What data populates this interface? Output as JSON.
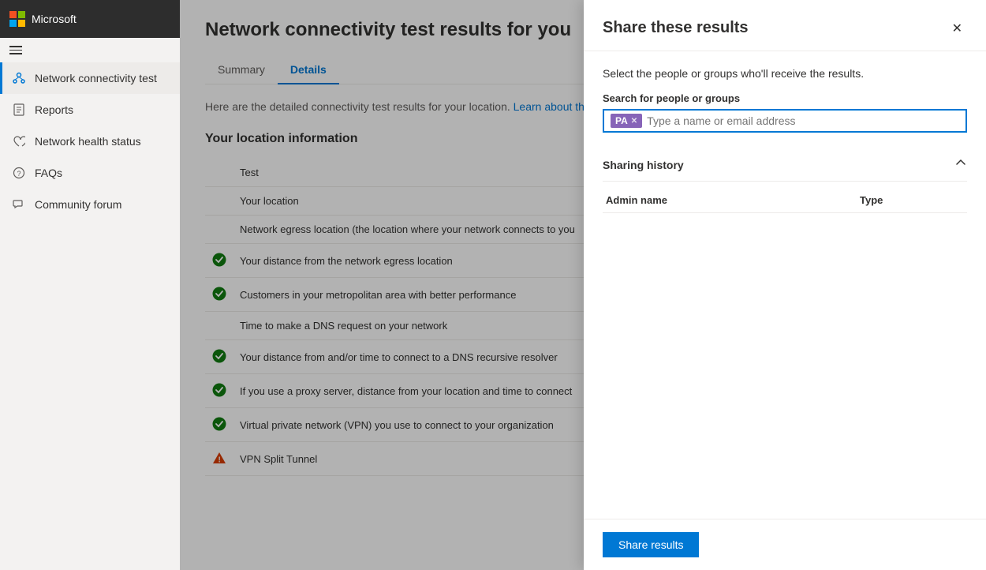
{
  "app": {
    "brand": "Microsoft"
  },
  "sidebar": {
    "items": [
      {
        "id": "network-connectivity",
        "label": "Network connectivity test",
        "icon": "network-icon",
        "active": true
      },
      {
        "id": "reports",
        "label": "Reports",
        "icon": "reports-icon",
        "active": false
      },
      {
        "id": "network-health",
        "label": "Network health status",
        "icon": "health-icon",
        "active": false
      },
      {
        "id": "faqs",
        "label": "FAQs",
        "icon": "faqs-icon",
        "active": false
      },
      {
        "id": "community-forum",
        "label": "Community forum",
        "icon": "forum-icon",
        "active": false
      }
    ]
  },
  "main": {
    "page_title": "Network connectivity test results for you",
    "tabs": [
      {
        "id": "summary",
        "label": "Summary",
        "active": false
      },
      {
        "id": "details",
        "label": "Details",
        "active": true
      }
    ],
    "description": "Here are the detailed connectivity test results for your location.",
    "description_link": "Learn about the tests",
    "section_title": "Your location information",
    "table_headers": [
      "Test",
      "Your location"
    ],
    "rows": [
      {
        "status": "",
        "text": "Test"
      },
      {
        "status": "",
        "text": "Your location"
      },
      {
        "status": "",
        "text": "Network egress location (the location where your network connects to you"
      },
      {
        "status": "success",
        "text": "Your distance from the network egress location"
      },
      {
        "status": "success",
        "text": "Customers in your metropolitan area with better performance"
      },
      {
        "status": "",
        "text": "Time to make a DNS request on your network"
      },
      {
        "status": "success",
        "text": "Your distance from and/or time to connect to a DNS recursive resolver"
      },
      {
        "status": "success",
        "text": "If you use a proxy server, distance from your location and time to connect"
      },
      {
        "status": "success",
        "text": "Virtual private network (VPN) you use to connect to your organization"
      },
      {
        "status": "warning",
        "text": "VPN Split Tunnel"
      }
    ]
  },
  "panel": {
    "title": "Share these results",
    "subtitle": "Select the people or groups who'll receive the results.",
    "search_label": "Search for people or groups",
    "search_placeholder": "Type a name or email address",
    "tag_initials": "PA",
    "sharing_history_title": "Sharing history",
    "history_columns": [
      "Admin name",
      "Type"
    ],
    "share_button_label": "Share results"
  }
}
